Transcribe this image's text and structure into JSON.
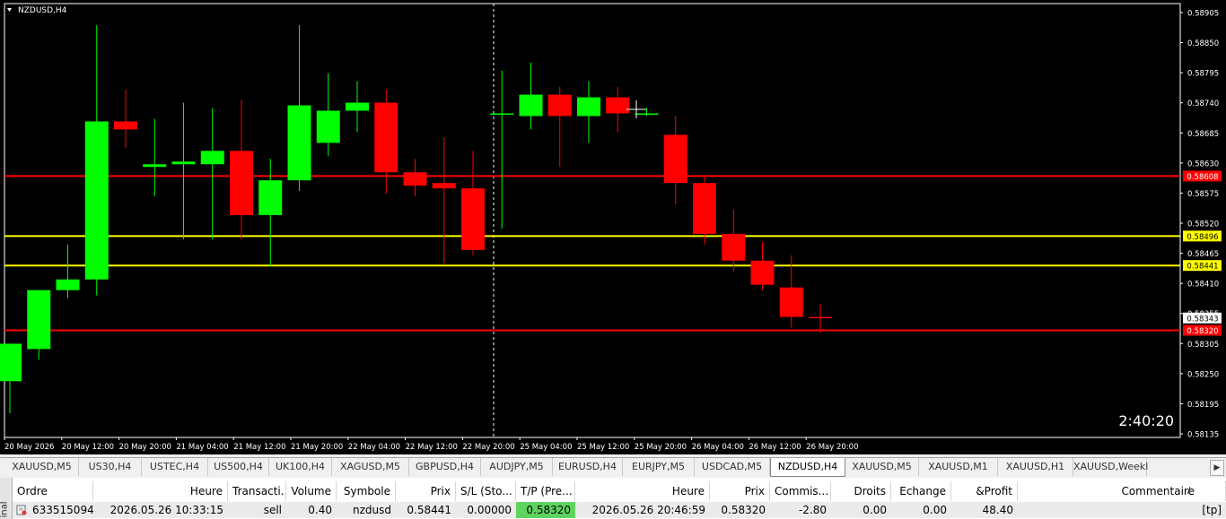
{
  "chart": {
    "symbol_title": "NZDUSD,H4",
    "timer": "2:40:20",
    "colors": {
      "background": "#000000",
      "bull": "#00ff00",
      "bear": "#ff0000",
      "level_red": "#ff0000",
      "level_yellow": "#ffff00",
      "axis_text": "#ffffff"
    },
    "price_axis": [
      "0.58905",
      "0.58850",
      "0.58795",
      "0.58740",
      "0.58685",
      "0.58630",
      "0.58575",
      "0.58520",
      "0.58465",
      "0.58410",
      "0.58355",
      "0.58305",
      "0.58250",
      "0.58195",
      "0.58135"
    ],
    "time_axis": [
      "20 May 2026",
      "20 May 12:00",
      "20 May 20:00",
      "21 May 04:00",
      "21 May 12:00",
      "21 May 20:00",
      "22 May 04:00",
      "22 May 12:00",
      "22 May 20:00",
      "25 May 04:00",
      "25 May 12:00",
      "25 May 20:00",
      "26 May 04:00",
      "26 May 12:00",
      "26 May 20:00"
    ],
    "levels": [
      {
        "price": 0.58608,
        "label": "0.58608",
        "color": "#ff0000"
      },
      {
        "price": 0.58496,
        "label": "0.58496",
        "color": "#ffff00"
      },
      {
        "price": 0.58441,
        "label": "0.58441",
        "color": "#ffff00"
      },
      {
        "price": 0.5832,
        "label": "0.58320",
        "color": "#ff0000"
      }
    ],
    "current_price": {
      "price": 0.58343,
      "label": "0.58343"
    }
  },
  "chart_data": {
    "type": "candlestick",
    "symbol": "NZDUSD",
    "timeframe": "H4",
    "ylim": [
      0.5812,
      0.5893
    ],
    "candles": [
      {
        "o": 0.58225,
        "h": 0.58295,
        "l": 0.58165,
        "c": 0.58295
      },
      {
        "o": 0.58285,
        "h": 0.58395,
        "l": 0.58265,
        "c": 0.58395
      },
      {
        "o": 0.58395,
        "h": 0.5848,
        "l": 0.5838,
        "c": 0.58415
      },
      {
        "o": 0.58415,
        "h": 0.5889,
        "l": 0.58385,
        "c": 0.5871
      },
      {
        "o": 0.5871,
        "h": 0.5877,
        "l": 0.5866,
        "c": 0.58695
      },
      {
        "o": 0.58625,
        "h": 0.58715,
        "l": 0.5857,
        "c": 0.5863
      },
      {
        "o": 0.5863,
        "h": 0.58745,
        "l": 0.5849,
        "c": 0.58635
      },
      {
        "o": 0.5863,
        "h": 0.58735,
        "l": 0.5849,
        "c": 0.58655
      },
      {
        "o": 0.58655,
        "h": 0.5875,
        "l": 0.5849,
        "c": 0.58535
      },
      {
        "o": 0.58535,
        "h": 0.5864,
        "l": 0.5844,
        "c": 0.586
      },
      {
        "o": 0.586,
        "h": 0.5889,
        "l": 0.5858,
        "c": 0.5874
      },
      {
        "o": 0.5867,
        "h": 0.588,
        "l": 0.58645,
        "c": 0.5873
      },
      {
        "o": 0.5873,
        "h": 0.58785,
        "l": 0.5869,
        "c": 0.58745
      },
      {
        "o": 0.58745,
        "h": 0.5877,
        "l": 0.58575,
        "c": 0.58615
      },
      {
        "o": 0.58615,
        "h": 0.5864,
        "l": 0.5857,
        "c": 0.5859
      },
      {
        "o": 0.58595,
        "h": 0.5868,
        "l": 0.58445,
        "c": 0.58585
      },
      {
        "o": 0.58585,
        "h": 0.58655,
        "l": 0.5846,
        "c": 0.5847
      },
      {
        "o": 0.58725,
        "h": 0.58805,
        "l": 0.5851,
        "c": 0.58725
      },
      {
        "o": 0.5872,
        "h": 0.5882,
        "l": 0.58695,
        "c": 0.5876
      },
      {
        "o": 0.5876,
        "h": 0.58775,
        "l": 0.58625,
        "c": 0.5872
      },
      {
        "o": 0.5872,
        "h": 0.58785,
        "l": 0.5867,
        "c": 0.58755
      },
      {
        "o": 0.58755,
        "h": 0.58775,
        "l": 0.5869,
        "c": 0.58725
      },
      {
        "o": 0.58725,
        "h": 0.58735,
        "l": 0.5872,
        "c": 0.58725
      },
      {
        "o": 0.58685,
        "h": 0.5872,
        "l": 0.58555,
        "c": 0.58595
      },
      {
        "o": 0.58595,
        "h": 0.5861,
        "l": 0.5848,
        "c": 0.585
      },
      {
        "o": 0.585,
        "h": 0.58545,
        "l": 0.5843,
        "c": 0.5845
      },
      {
        "o": 0.5845,
        "h": 0.58485,
        "l": 0.58395,
        "c": 0.58405
      },
      {
        "o": 0.584,
        "h": 0.5846,
        "l": 0.58325,
        "c": 0.58345
      },
      {
        "o": 0.58345,
        "h": 0.5837,
        "l": 0.58315,
        "c": 0.58343
      }
    ]
  },
  "tabs": {
    "items": [
      "XAUUSD,M5",
      "US30,H4",
      "USTEC,H4",
      "US500,H4",
      "UK100,H4",
      "XAGUSD,M5",
      "GBPUSD,H4",
      "AUDJPY,M5",
      "EURUSD,H4",
      "EURJPY,M5",
      "USDCAD,M5",
      "NZDUSD,H4",
      "XAUUSD,M5",
      "XAUUSD,M1",
      "XAUUSD,H1",
      "XAUUSD,Weekl"
    ],
    "active": "NZDUSD,H4",
    "scroll_right_label": "▶"
  },
  "trade": {
    "side_label": "inal",
    "headers": [
      "Ordre",
      "Heure",
      "Transacti...",
      "Volume",
      "Symbole",
      "Prix",
      "S/L (Sto...",
      "T/P (Pre...",
      "Heure",
      "Prix",
      "Commis...",
      "Droits",
      "Echange",
      "&Profit",
      "Commentaire"
    ],
    "row": {
      "order": "633515094",
      "open_time": "2026.05.26 10:33:15",
      "type": "sell",
      "volume": "0.40",
      "symbol": "nzdusd",
      "price": "0.58441",
      "sl": "0.00000",
      "tp": "0.58320",
      "time": "2026.05.26 20:46:59",
      "current_price": "0.58320",
      "commission": "-2.80",
      "swap_rights": "0.00",
      "exchange": "0.00",
      "profit": "48.40",
      "comment": "[tp]"
    },
    "tp_highlight_color": "#5fd35f"
  }
}
